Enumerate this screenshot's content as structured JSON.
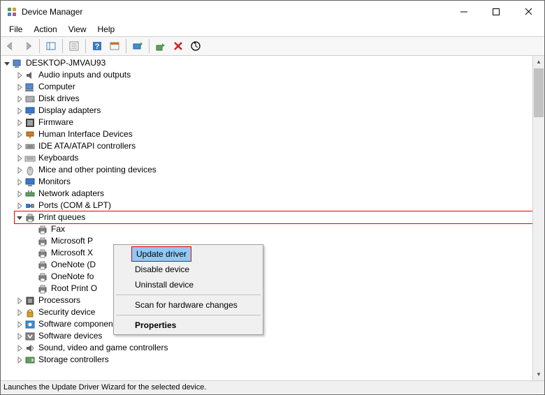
{
  "window": {
    "title": "Device Manager"
  },
  "menus": {
    "file": "File",
    "action": "Action",
    "view": "View",
    "help": "Help"
  },
  "tree": {
    "root": "DESKTOP-JMVAU93",
    "categories": [
      {
        "label": "Audio inputs and outputs",
        "icon": "audio"
      },
      {
        "label": "Computer",
        "icon": "computer"
      },
      {
        "label": "Disk drives",
        "icon": "disk"
      },
      {
        "label": "Display adapters",
        "icon": "display"
      },
      {
        "label": "Firmware",
        "icon": "firmware"
      },
      {
        "label": "Human Interface Devices",
        "icon": "hid"
      },
      {
        "label": "IDE ATA/ATAPI controllers",
        "icon": "ide"
      },
      {
        "label": "Keyboards",
        "icon": "keyboard"
      },
      {
        "label": "Mice and other pointing devices",
        "icon": "mouse"
      },
      {
        "label": "Monitors",
        "icon": "monitor"
      },
      {
        "label": "Network adapters",
        "icon": "network"
      },
      {
        "label": "Ports (COM & LPT)",
        "icon": "ports"
      },
      {
        "label": "Print queues",
        "icon": "printer",
        "expanded": true,
        "highlighted": true,
        "children": [
          {
            "label": "Fax"
          },
          {
            "label": "Microsoft P"
          },
          {
            "label": "Microsoft X"
          },
          {
            "label": "OneNote (D"
          },
          {
            "label": "OneNote fo"
          },
          {
            "label": "Root Print O"
          }
        ]
      },
      {
        "label": "Processors",
        "icon": "processor"
      },
      {
        "label": "Security device",
        "icon": "security"
      },
      {
        "label": "Software components",
        "icon": "swcomp"
      },
      {
        "label": "Software devices",
        "icon": "swdev"
      },
      {
        "label": "Sound, video and game controllers",
        "icon": "sound"
      },
      {
        "label": "Storage controllers",
        "icon": "storage"
      }
    ]
  },
  "context_menu": {
    "items": {
      "update": "Update driver",
      "disable": "Disable device",
      "uninstall": "Uninstall device",
      "scan": "Scan for hardware changes",
      "properties": "Properties"
    }
  },
  "statusbar": {
    "text": "Launches the Update Driver Wizard for the selected device."
  }
}
